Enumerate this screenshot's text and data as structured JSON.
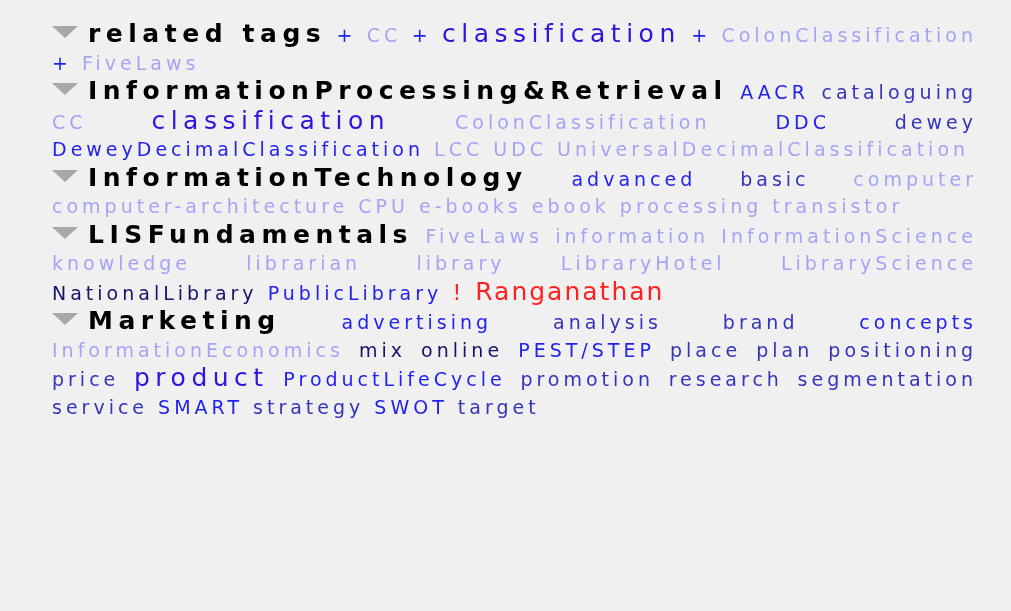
{
  "sections": [
    {
      "title": "related tags",
      "expanded": true,
      "tags": [
        {
          "add": "+",
          "text": "CC",
          "kind": "light"
        },
        {
          "add": "+",
          "text": "classification",
          "kind": "big"
        },
        {
          "add": "+",
          "text": "ColonClassification",
          "kind": "light"
        },
        {
          "add": "+",
          "text": "FiveLaws",
          "kind": "light"
        }
      ]
    },
    {
      "title": "InformationProcessing&Retrieval",
      "expanded": true,
      "tags": [
        {
          "text": "AACR",
          "kind": "bright"
        },
        {
          "text": "cataloguing",
          "kind": "dark"
        },
        {
          "text": "CC",
          "kind": "light"
        },
        {
          "text": "classification",
          "kind": "big"
        },
        {
          "text": "ColonClassification",
          "kind": "light"
        },
        {
          "text": "DDC",
          "kind": "bright"
        },
        {
          "text": "dewey",
          "kind": "dark"
        },
        {
          "text": "DeweyDecimalClassification",
          "kind": "bright"
        },
        {
          "text": "LCC",
          "kind": "light"
        },
        {
          "text": "UDC",
          "kind": "light"
        },
        {
          "text": "UniversalDecimalClassification",
          "kind": "light"
        }
      ]
    },
    {
      "title": "InformationTechnology",
      "expanded": true,
      "tags": [
        {
          "text": "advanced",
          "kind": "bright"
        },
        {
          "text": "basic",
          "kind": "dark"
        },
        {
          "text": "computer",
          "kind": "light"
        },
        {
          "text": "computer-architecture",
          "kind": "light"
        },
        {
          "text": "CPU",
          "kind": "light"
        },
        {
          "text": "e-books",
          "kind": "light"
        },
        {
          "text": "ebook",
          "kind": "light"
        },
        {
          "text": "processing",
          "kind": "light"
        },
        {
          "text": "transistor",
          "kind": "light"
        }
      ]
    },
    {
      "title": "LISFundamentals",
      "expanded": true,
      "tags": [
        {
          "text": "FiveLaws",
          "kind": "light"
        },
        {
          "text": "information",
          "kind": "light"
        },
        {
          "text": "InformationScience",
          "kind": "light"
        },
        {
          "text": "knowledge",
          "kind": "light"
        },
        {
          "text": "librarian",
          "kind": "light"
        },
        {
          "text": "library",
          "kind": "light"
        },
        {
          "text": "LibraryHotel",
          "kind": "light"
        },
        {
          "text": "LibraryScience",
          "kind": "light"
        },
        {
          "text": "NationalLibrary",
          "kind": "navy"
        },
        {
          "text": "PublicLibrary",
          "kind": "bright"
        },
        {
          "mark": "!",
          "text": "Ranganathan",
          "kind": "alert"
        }
      ]
    },
    {
      "title": "Marketing",
      "expanded": true,
      "tags": [
        {
          "text": "advertising",
          "kind": "bright"
        },
        {
          "text": "analysis",
          "kind": "dark"
        },
        {
          "text": "brand",
          "kind": "dark"
        },
        {
          "text": "concepts",
          "kind": "bright"
        },
        {
          "text": "InformationEconomics",
          "kind": "light"
        },
        {
          "text": "mix",
          "kind": "navy"
        },
        {
          "text": "online",
          "kind": "navy"
        },
        {
          "text": "PEST/STEP",
          "kind": "bright"
        },
        {
          "text": "place",
          "kind": "dark"
        },
        {
          "text": "plan",
          "kind": "dark"
        },
        {
          "text": "positioning",
          "kind": "dark"
        },
        {
          "text": "price",
          "kind": "dark"
        },
        {
          "text": "product",
          "kind": "big"
        },
        {
          "text": "ProductLifeCycle",
          "kind": "bright"
        },
        {
          "text": "promotion",
          "kind": "dark"
        },
        {
          "text": "research",
          "kind": "dark"
        },
        {
          "text": "segmentation",
          "kind": "dark"
        },
        {
          "text": "service",
          "kind": "dark"
        },
        {
          "text": "SMART",
          "kind": "bright"
        },
        {
          "text": "strategy",
          "kind": "dark"
        },
        {
          "text": "SWOT",
          "kind": "bright"
        },
        {
          "text": "target",
          "kind": "dark"
        }
      ]
    }
  ]
}
